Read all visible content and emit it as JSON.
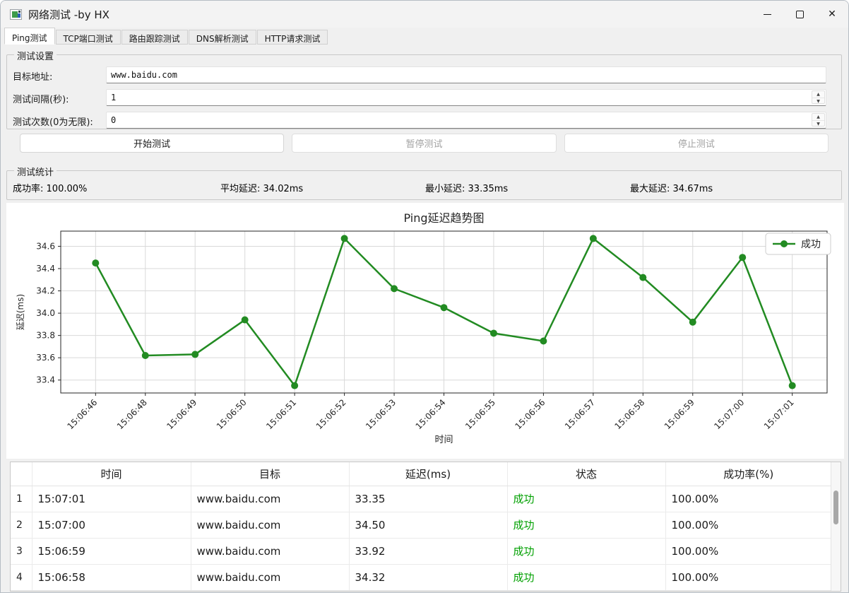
{
  "window": {
    "title": "网络测试 -by HX",
    "icons": {
      "close_glyph": "✕"
    }
  },
  "tabs": [
    {
      "label": "Ping测试",
      "active": true
    },
    {
      "label": "TCP端口测试",
      "active": false
    },
    {
      "label": "路由跟踪测试",
      "active": false
    },
    {
      "label": "DNS解析测试",
      "active": false
    },
    {
      "label": "HTTP请求测试",
      "active": false
    }
  ],
  "settings": {
    "group_title": "测试设置",
    "fields": [
      {
        "label": "目标地址:",
        "value": "www.baidu.com",
        "type": "entry"
      },
      {
        "label": "测试间隔(秒):",
        "value": "1",
        "type": "spinbox"
      },
      {
        "label": "测试次数(0为无限):",
        "value": "0",
        "type": "spinbox"
      }
    ]
  },
  "actions": [
    {
      "label": "开始测试",
      "enabled": true
    },
    {
      "label": "暂停测试",
      "enabled": false
    },
    {
      "label": "停止测试",
      "enabled": false
    }
  ],
  "stats": {
    "group_title": "测试统计",
    "items": [
      {
        "label": "成功率:",
        "value": "100.00%"
      },
      {
        "label": "平均延迟:",
        "value": "34.02ms"
      },
      {
        "label": "最小延迟:",
        "value": "33.35ms"
      },
      {
        "label": "最大延迟:",
        "value": "34.67ms"
      }
    ]
  },
  "chart_data": {
    "type": "line",
    "title": "Ping延迟趋势图",
    "xlabel": "时间",
    "ylabel": "延迟(ms)",
    "grid": true,
    "legend_position": "top-right",
    "categories": [
      "15:06:46",
      "15:06:48",
      "15:06:49",
      "15:06:50",
      "15:06:51",
      "15:06:52",
      "15:06:53",
      "15:06:54",
      "15:06:55",
      "15:06:56",
      "15:06:57",
      "15:06:58",
      "15:06:59",
      "15:07:00",
      "15:07:01"
    ],
    "series": [
      {
        "name": "成功",
        "color": "#228B22",
        "values": [
          34.45,
          33.62,
          33.63,
          33.94,
          33.35,
          34.67,
          34.22,
          34.05,
          33.82,
          33.75,
          34.67,
          34.32,
          33.92,
          34.5,
          33.35
        ]
      }
    ],
    "yticks": [
      33.4,
      33.6,
      33.8,
      34.0,
      34.2,
      34.4,
      34.6
    ],
    "ylim": [
      33.284,
      34.736
    ]
  },
  "table": {
    "headers": [
      "",
      "时间",
      "目标",
      "延迟(ms)",
      "状态",
      "成功率(%)"
    ],
    "status_color": "#00a000",
    "rows": [
      {
        "num": "1",
        "time": "15:07:01",
        "target": "www.baidu.com",
        "delay": "33.35",
        "status": "成功",
        "rate": "100.00%"
      },
      {
        "num": "2",
        "time": "15:07:00",
        "target": "www.baidu.com",
        "delay": "34.50",
        "status": "成功",
        "rate": "100.00%"
      },
      {
        "num": "3",
        "time": "15:06:59",
        "target": "www.baidu.com",
        "delay": "33.92",
        "status": "成功",
        "rate": "100.00%"
      },
      {
        "num": "4",
        "time": "15:06:58",
        "target": "www.baidu.com",
        "delay": "34.32",
        "status": "成功",
        "rate": "100.00%"
      }
    ]
  }
}
